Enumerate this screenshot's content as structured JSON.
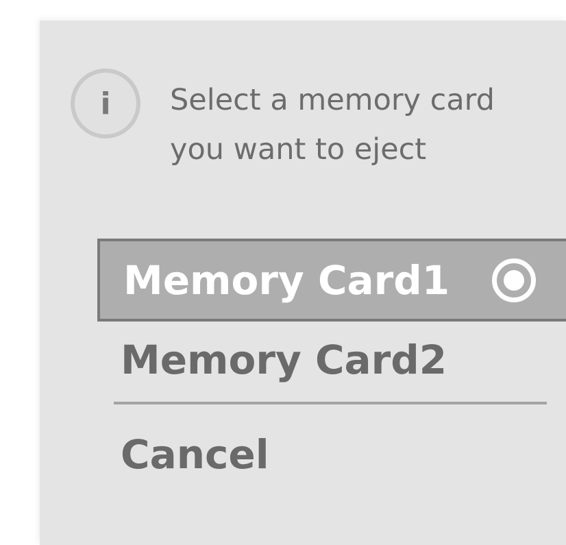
{
  "dialog": {
    "icon": "info-icon",
    "icon_glyph": "i",
    "message_lines": [
      "Select a memory card",
      "you want to eject"
    ],
    "options": [
      {
        "label": "Memory Card1",
        "selected": true
      },
      {
        "label": "Memory Card2",
        "selected": false
      }
    ],
    "cancel_label": "Cancel"
  }
}
